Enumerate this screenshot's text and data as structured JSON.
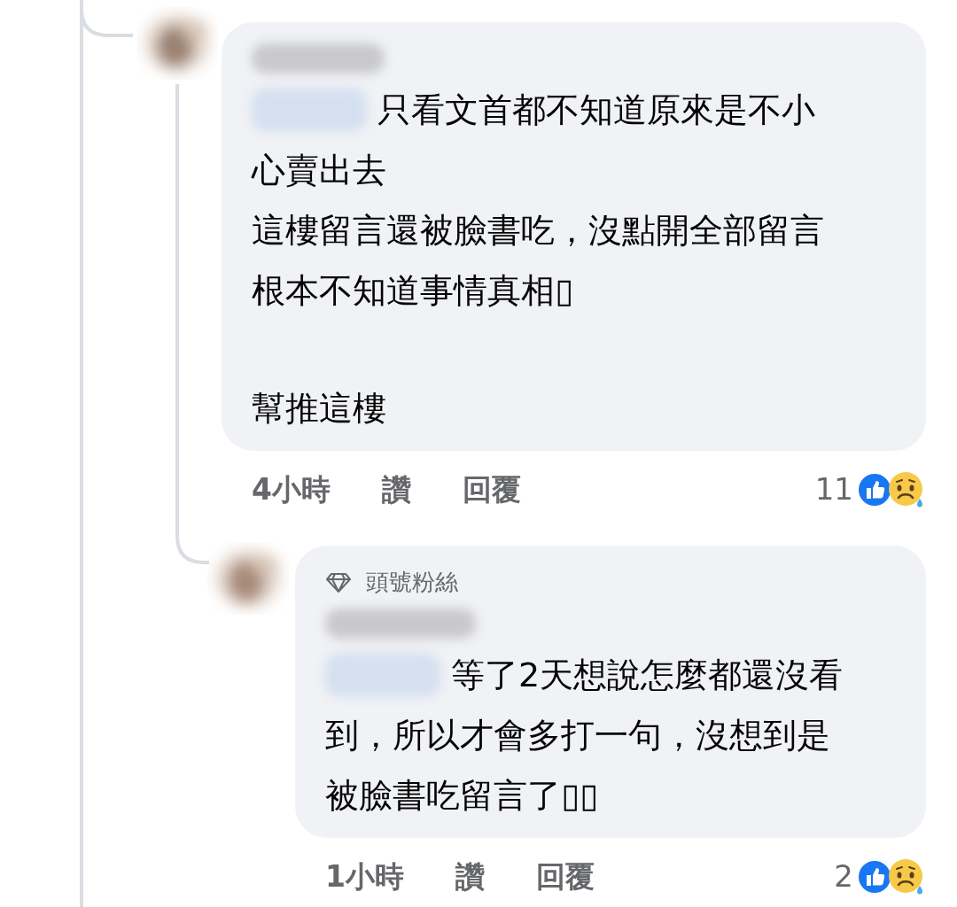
{
  "comments": [
    {
      "paragraphs": [
        [
          "只看文首都不知道原來是不小",
          "心賣出去",
          "這樓留言還被臉書吃，沒點開全部留言",
          "根本不知道事情真相▯"
        ],
        [
          "幫推這樓"
        ]
      ],
      "time": "4小時",
      "like": "讚",
      "reply": "回覆",
      "reaction_count": "11"
    },
    {
      "badge": "頭號粉絲",
      "paragraphs": [
        [
          "等了2天想說怎麼都還沒看",
          "到，所以才會多打一句，沒想到是",
          "被臉書吃留言了▯▯"
        ]
      ],
      "time": "1小時",
      "like": "讚",
      "reply": "回覆",
      "reaction_count": "2"
    }
  ]
}
